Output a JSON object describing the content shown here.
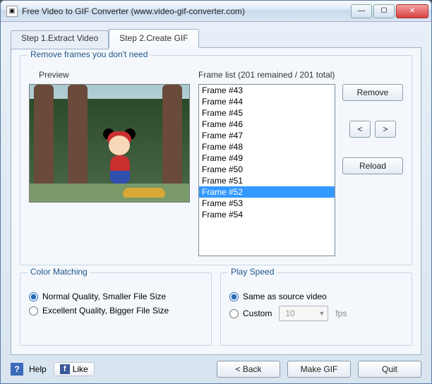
{
  "window": {
    "title": "Free Video to GIF Converter (www.video-gif-converter.com)"
  },
  "tabs": {
    "step1": "Step 1.Extract Video",
    "step2": "Step 2.Create GIF"
  },
  "removeFrames": {
    "groupTitle": "Remove frames you don't need",
    "previewLabel": "Preview",
    "frameListLabel": "Frame list (201 remained / 201 total)",
    "frames": [
      "Frame #43",
      "Frame #44",
      "Frame #45",
      "Frame #46",
      "Frame #47",
      "Frame #48",
      "Frame #49",
      "Frame #50",
      "Frame #51",
      "Frame #52",
      "Frame #53",
      "Frame #54"
    ],
    "selectedIndex": 9,
    "buttons": {
      "remove": "Remove",
      "prev": "<",
      "next": ">",
      "reload": "Reload"
    }
  },
  "colorMatching": {
    "groupTitle": "Color Matching",
    "options": {
      "normal": "Normal Quality, Smaller File Size",
      "excellent": "Excellent Quality, Bigger File Size"
    },
    "selected": "normal"
  },
  "playSpeed": {
    "groupTitle": "Play Speed",
    "options": {
      "same": "Same as source video",
      "custom": "Custom"
    },
    "selected": "same",
    "customValue": "10",
    "fpsLabel": "fps"
  },
  "footer": {
    "help": "Help",
    "like": "Like",
    "back": "< Back",
    "make": "Make GIF",
    "quit": "Quit"
  }
}
